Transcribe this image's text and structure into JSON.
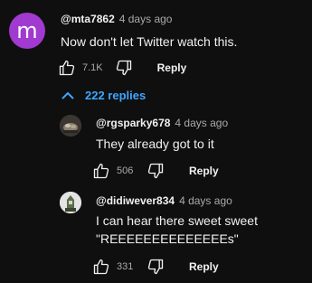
{
  "comment": {
    "avatar_letter": "m",
    "author": "@mta7862",
    "time": "4 days ago",
    "text": "Now don't let Twitter watch this.",
    "likes": "7.1K",
    "reply_label": "Reply"
  },
  "replies_toggle": {
    "label": "222 replies"
  },
  "replies": [
    {
      "author": "@rgsparky678",
      "time": "4 days ago",
      "text_lines": [
        "They already got to it"
      ],
      "likes": "506",
      "reply_label": "Reply"
    },
    {
      "author": "@didiwever834",
      "time": "4 days ago",
      "text_lines": [
        "I can hear there sweet sweet",
        "\"REEEEEEEEEEEEEEs\""
      ],
      "likes": "331",
      "reply_label": "Reply"
    }
  ],
  "colors": {
    "background": "#0f0f0f",
    "avatar_main": "#a13ad0",
    "link_blue": "#3ea6ff",
    "secondary_text": "#aaaaaa"
  }
}
